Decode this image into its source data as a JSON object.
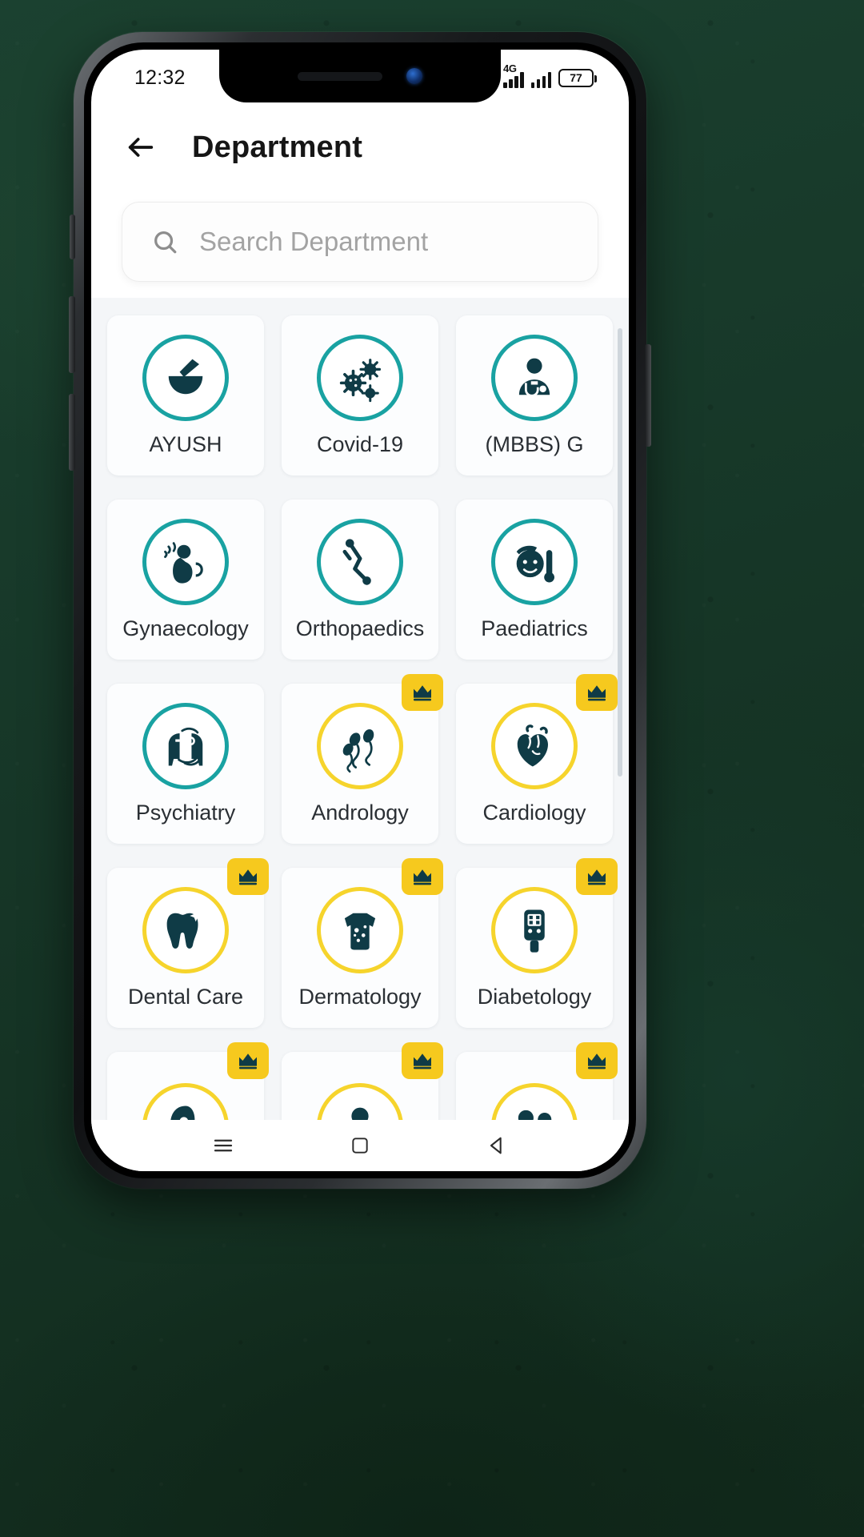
{
  "status_bar": {
    "time": "12:32",
    "network_label": "4G",
    "battery_percent": "77",
    "icons": [
      "signal-bars-icon",
      "signal-bars-icon",
      "battery-icon"
    ]
  },
  "header": {
    "back_label": "back-arrow-icon",
    "title": "Department"
  },
  "search": {
    "placeholder": "Search Department",
    "value": "",
    "icon": "search-icon"
  },
  "colors": {
    "accent_teal": "#19A2A2",
    "icon_dark": "#0F3B46",
    "premium_yellow": "#F6D42C",
    "crown_badge": "#F6C91E",
    "page_bg": "#F4F6F8",
    "card_bg": "#FCFDFE",
    "label_text": "#2A2F34"
  },
  "grid": {
    "premium_badge_icon": "crown-icon",
    "departments": [
      {
        "label": "AYUSH",
        "icon": "mortar-pestle-icon",
        "premium": false
      },
      {
        "label": "Covid-19",
        "icon": "virus-icon",
        "premium": false
      },
      {
        "label": "(MBBS)  G",
        "icon": "doctor-stethoscope-icon",
        "premium": false
      },
      {
        "label": "Gynaecology",
        "icon": "pregnant-woman-icon",
        "premium": false
      },
      {
        "label": "Orthopaedics",
        "icon": "bone-joint-icon",
        "premium": false
      },
      {
        "label": "Paediatrics",
        "icon": "child-thermometer-icon",
        "premium": false
      },
      {
        "label": "Psychiatry",
        "icon": "mind-heads-icon",
        "premium": false
      },
      {
        "label": "Andrology",
        "icon": "sperm-icon",
        "premium": true
      },
      {
        "label": "Cardiology",
        "icon": "heart-organ-icon",
        "premium": true
      },
      {
        "label": "Dental Care",
        "icon": "tooth-icon",
        "premium": true
      },
      {
        "label": "Dermatology",
        "icon": "skin-torso-icon",
        "premium": true
      },
      {
        "label": "Diabetology",
        "icon": "glucometer-icon",
        "premium": true
      },
      {
        "label": "",
        "icon": "ear-icon",
        "premium": true
      },
      {
        "label": "",
        "icon": "person-icon",
        "premium": true
      },
      {
        "label": "",
        "icon": "two-people-icon",
        "premium": true
      }
    ]
  },
  "nav_bar": {
    "items": [
      {
        "icon": "menu-icon"
      },
      {
        "icon": "home-square-icon"
      },
      {
        "icon": "back-triangle-icon"
      }
    ]
  }
}
